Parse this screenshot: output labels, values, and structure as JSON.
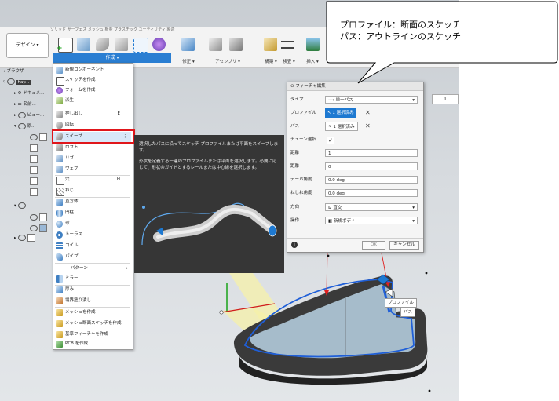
{
  "toolbar": {
    "design_button": "デザイン",
    "tabs_faded": "ソリッド   サーフェス   メッシュ   板金   プラスチック   ユーティリティ   製造",
    "groups": {
      "create": "作成",
      "modify": "修正",
      "assemble": "アセンブリ",
      "construct": "構築",
      "inspect": "検査",
      "insert": "挿入"
    }
  },
  "browser": {
    "title": "ブラウザ",
    "items": [
      "hay...",
      "ドキュメ...",
      "名前...",
      "ビュー...",
      "原..."
    ]
  },
  "menu": {
    "items": [
      {
        "label": "新規コンポーネント",
        "shortcut": ""
      },
      {
        "label": "スケッチを作成",
        "shortcut": ""
      },
      {
        "label": "フォームを作成",
        "shortcut": ""
      },
      {
        "label": "派生",
        "shortcut": ""
      },
      {
        "label": "押し出し",
        "shortcut": "E"
      },
      {
        "label": "回転",
        "shortcut": ""
      },
      {
        "label": "スイープ",
        "shortcut": "⋮"
      },
      {
        "label": "ロフト",
        "shortcut": ""
      },
      {
        "label": "リブ",
        "shortcut": ""
      },
      {
        "label": "ウェブ",
        "shortcut": ""
      },
      {
        "label": "穴",
        "shortcut": "H"
      },
      {
        "label": "ねじ",
        "shortcut": ""
      },
      {
        "label": "直方体",
        "shortcut": ""
      },
      {
        "label": "円柱",
        "shortcut": ""
      },
      {
        "label": "球",
        "shortcut": ""
      },
      {
        "label": "トーラス",
        "shortcut": ""
      },
      {
        "label": "コイル",
        "shortcut": ""
      },
      {
        "label": "パイプ",
        "shortcut": ""
      },
      {
        "label": "パターン",
        "shortcut": "▸"
      },
      {
        "label": "ミラー",
        "shortcut": ""
      },
      {
        "label": "厚み",
        "shortcut": ""
      },
      {
        "label": "境界塗り潰し",
        "shortcut": ""
      },
      {
        "label": "メッシュを作成",
        "shortcut": ""
      },
      {
        "label": "メッシュ断面スケッチを作成",
        "shortcut": ""
      },
      {
        "label": "基準フィーチャを作成",
        "shortcut": ""
      },
      {
        "label": "PCB を作成",
        "shortcut": ""
      }
    ]
  },
  "tooltip": {
    "line1": "選択したパスに沿ってスケッチ プロファイルまたは平面をスイープします。",
    "line2": "形状を定義する一連のプロファイルまたは平面を選択します。必要に応じて、形状のガイドとするレールまたは中心線を選択します。"
  },
  "dialog": {
    "title": "フィーチャ編集",
    "type_label": "タイプ",
    "type_value": "単一パス",
    "profile_label": "プロファイル",
    "profile_value": "1 選択済み",
    "path_label": "パス",
    "path_value": "1 選択済み",
    "chain_label": "チェーン選択",
    "distance1_label": "距離",
    "distance1_value": "1",
    "distance2_label": "距離",
    "distance2_value": "0",
    "taper_label": "テーパ角度",
    "taper_value": "0.0 deg",
    "twist_label": "ねじれ角度",
    "twist_value": "0.0 deg",
    "orientation_label": "方向",
    "orientation_value": "直交",
    "operation_label": "操作",
    "operation_value": "新規ボディ",
    "ok": "OK",
    "cancel": "キャンセル"
  },
  "viewport": {
    "scale_value": "1",
    "label_profile": "プロファイル",
    "label_path": "パス"
  },
  "callout": {
    "line1": "プロファイル：断面のスケッチ",
    "line2": "パス：アウトラインのスケッチ"
  },
  "colors": {
    "accent": "#1e79d1",
    "highlight_box": "#e0161b",
    "path_line": "#1f5fd8",
    "tooltip_bg": "#363636"
  }
}
